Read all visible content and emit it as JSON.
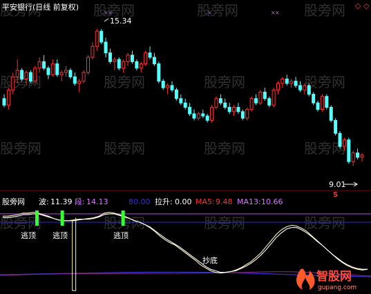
{
  "title": "平安银行(日线 前复权)",
  "price_labels": {
    "high": "15.34",
    "low": "9.01"
  },
  "watermark": "股旁网",
  "indicator_name": "股旁网",
  "indicator_values": [
    {
      "label": "波:",
      "value": "11.39",
      "color": "#ffffff"
    },
    {
      "label": "段:",
      "value": "14.13",
      "color": "#d878ff"
    },
    {
      "label": "",
      "value": "80.00",
      "color": "#3030d0"
    },
    {
      "label": "拉升:",
      "value": "0.00",
      "color": "#ffffff"
    },
    {
      "label": "MA5:",
      "value": "9.48",
      "color": "#ff3030"
    },
    {
      "label": "MA13:",
      "value": "10.66",
      "color": "#d878ff"
    }
  ],
  "annotations": {
    "escape_top": "逃顶",
    "bottom_fish": "抄底",
    "low_marker": "S"
  },
  "logo": {
    "text": "智股网",
    "sub": "gupang.com"
  },
  "colors": {
    "up": "#ff3333",
    "down": "#54ffff",
    "cross": "#d060ff",
    "purple_line": "#c040ff",
    "blue_line": "#3030d0",
    "signal": "#33ff33"
  },
  "chart_data": [
    {
      "type": "candlestick",
      "title": "平安银行(日线 前复权)",
      "y_range": [
        8.0,
        16.0
      ],
      "annotations": {
        "max": 15.34,
        "min": 9.01
      },
      "candles": [
        [
          12.1,
          12.3,
          11.7,
          11.8
        ],
        [
          11.8,
          12.6,
          11.6,
          12.5
        ],
        [
          12.5,
          13.3,
          12.3,
          13.1
        ],
        [
          13.1,
          13.9,
          12.8,
          13.4
        ],
        [
          13.4,
          13.5,
          12.9,
          13.0
        ],
        [
          13.0,
          13.4,
          12.7,
          13.3
        ],
        [
          13.3,
          13.4,
          12.8,
          12.9
        ],
        [
          12.9,
          13.6,
          12.8,
          13.5
        ],
        [
          13.5,
          14.0,
          13.3,
          13.8
        ],
        [
          13.8,
          14.1,
          13.4,
          13.5
        ],
        [
          13.5,
          13.6,
          13.0,
          13.2
        ],
        [
          13.2,
          13.9,
          13.1,
          13.7
        ],
        [
          13.7,
          13.9,
          13.1,
          13.2
        ],
        [
          13.2,
          13.4,
          12.9,
          13.3
        ],
        [
          13.3,
          13.6,
          13.1,
          13.4
        ],
        [
          13.4,
          13.5,
          13.0,
          13.1
        ],
        [
          13.1,
          13.3,
          12.7,
          12.8
        ],
        [
          12.8,
          13.0,
          12.4,
          12.9
        ],
        [
          12.9,
          13.4,
          12.8,
          13.3
        ],
        [
          13.3,
          14.1,
          13.2,
          14.0
        ],
        [
          14.0,
          14.7,
          13.9,
          14.5
        ],
        [
          14.5,
          15.3,
          14.3,
          15.2
        ],
        [
          15.2,
          15.3,
          14.6,
          14.7
        ],
        [
          14.7,
          14.9,
          14.0,
          14.2
        ],
        [
          14.2,
          14.4,
          13.7,
          13.8
        ],
        [
          13.8,
          14.0,
          13.4,
          13.9
        ],
        [
          13.9,
          14.0,
          13.4,
          13.5
        ],
        [
          13.5,
          13.9,
          13.3,
          13.8
        ],
        [
          13.8,
          14.2,
          13.6,
          14.1
        ],
        [
          14.1,
          14.3,
          13.7,
          13.8
        ],
        [
          13.8,
          13.9,
          13.4,
          13.5
        ],
        [
          13.5,
          13.8,
          13.3,
          13.7
        ],
        [
          13.7,
          14.3,
          13.6,
          14.2
        ],
        [
          14.2,
          14.5,
          13.9,
          14.0
        ],
        [
          14.0,
          14.2,
          13.6,
          13.7
        ],
        [
          13.7,
          13.8,
          12.8,
          12.9
        ],
        [
          12.9,
          13.0,
          12.5,
          12.6
        ],
        [
          12.6,
          12.8,
          12.3,
          12.7
        ],
        [
          12.7,
          12.9,
          12.4,
          12.5
        ],
        [
          12.5,
          12.6,
          12.0,
          12.1
        ],
        [
          12.1,
          12.3,
          11.8,
          11.9
        ],
        [
          11.9,
          12.1,
          11.6,
          11.7
        ],
        [
          11.7,
          11.9,
          11.3,
          11.4
        ],
        [
          11.4,
          11.6,
          11.1,
          11.2
        ],
        [
          11.2,
          11.5,
          11.1,
          11.4
        ],
        [
          11.4,
          11.6,
          11.2,
          11.3
        ],
        [
          11.3,
          11.4,
          11.0,
          11.1
        ],
        [
          11.1,
          11.8,
          11.0,
          11.7
        ],
        [
          11.7,
          12.2,
          11.6,
          12.1
        ],
        [
          12.1,
          12.3,
          11.8,
          11.9
        ],
        [
          11.9,
          12.1,
          11.6,
          11.7
        ],
        [
          11.7,
          11.9,
          11.4,
          11.5
        ],
        [
          11.5,
          11.8,
          11.3,
          11.7
        ],
        [
          11.7,
          11.9,
          11.4,
          11.5
        ],
        [
          11.5,
          11.6,
          11.1,
          11.2
        ],
        [
          11.2,
          11.7,
          11.1,
          11.6
        ],
        [
          11.6,
          12.2,
          11.5,
          12.1
        ],
        [
          12.1,
          12.3,
          11.8,
          11.9
        ],
        [
          11.9,
          12.5,
          11.8,
          12.4
        ],
        [
          12.4,
          12.6,
          12.0,
          12.1
        ],
        [
          12.1,
          12.2,
          11.7,
          11.8
        ],
        [
          11.8,
          12.6,
          11.7,
          12.5
        ],
        [
          12.5,
          12.9,
          12.3,
          12.8
        ],
        [
          12.8,
          13.1,
          12.6,
          13.0
        ],
        [
          13.0,
          13.2,
          12.7,
          12.8
        ],
        [
          12.8,
          13.0,
          12.6,
          12.9
        ],
        [
          12.9,
          13.1,
          12.6,
          12.7
        ],
        [
          12.7,
          12.9,
          12.4,
          12.5
        ],
        [
          12.5,
          12.8,
          12.3,
          12.7
        ],
        [
          12.7,
          12.8,
          12.2,
          12.3
        ],
        [
          12.3,
          12.4,
          11.8,
          11.9
        ],
        [
          11.9,
          12.0,
          11.5,
          11.6
        ],
        [
          11.6,
          12.3,
          11.5,
          12.2
        ],
        [
          12.2,
          12.3,
          11.6,
          11.7
        ],
        [
          11.7,
          11.8,
          11.0,
          11.1
        ],
        [
          11.1,
          11.2,
          10.4,
          10.5
        ],
        [
          10.5,
          10.6,
          9.8,
          9.9
        ],
        [
          9.9,
          10.3,
          9.7,
          10.2
        ],
        [
          10.2,
          10.3,
          9.1,
          9.2
        ],
        [
          9.2,
          9.7,
          9.0,
          9.6
        ],
        [
          9.6,
          9.8,
          9.3,
          9.4
        ],
        [
          9.4,
          9.6,
          9.2,
          9.5
        ]
      ]
    },
    {
      "type": "line",
      "name": "股旁网",
      "y_range": [
        0,
        100
      ],
      "series": [
        {
          "name": "波",
          "color": "#ffffff",
          "values": [
            88,
            88,
            89,
            90,
            92,
            92,
            93,
            92,
            90,
            88,
            85,
            83,
            82,
            82,
            83,
            84,
            84,
            85,
            86,
            88,
            92,
            93,
            92,
            90,
            88,
            85,
            82,
            80,
            77,
            73,
            68,
            62,
            57,
            53,
            50,
            45,
            40,
            35,
            30,
            24,
            20,
            16,
            14,
            13,
            14,
            15,
            17,
            20,
            24,
            28,
            34,
            40,
            48,
            56,
            64,
            70,
            74,
            76,
            75,
            72,
            68,
            62,
            56,
            50,
            44,
            38,
            32,
            27,
            23,
            20,
            18,
            17,
            18
          ]
        },
        {
          "name": "段",
          "color": "#d878ff",
          "values": [
            86,
            86,
            87,
            88,
            90,
            90,
            91,
            91,
            89,
            87,
            85,
            83,
            82,
            82,
            82,
            83,
            84,
            84,
            85,
            87,
            90,
            91,
            91,
            89,
            87,
            85,
            82,
            80,
            77,
            74,
            69,
            64,
            59,
            55,
            51,
            47,
            42,
            37,
            32,
            27,
            22,
            18,
            16,
            14,
            14,
            15,
            16,
            19,
            22,
            26,
            31,
            37,
            44,
            52,
            60,
            66,
            71,
            73,
            73,
            70,
            66,
            61,
            55,
            50,
            44,
            38,
            33,
            28,
            24,
            21,
            19,
            18,
            18
          ]
        }
      ],
      "reference_lines": [
        {
          "name": "80.00",
          "value": 80.0,
          "color": "#3030d0"
        },
        {
          "value": 91.0,
          "color": "#c040ff"
        }
      ],
      "signals": [
        {
          "type": "逃顶",
          "index": 3
        },
        {
          "type": "逃顶",
          "index": 8
        },
        {
          "type": "逃顶",
          "index": 20
        },
        {
          "type": "抄底",
          "index": 42
        }
      ],
      "values_shown": {
        "波": 11.39,
        "段": 14.13,
        "拉升": 0.0,
        "MA5": 9.48,
        "MA13": 10.66
      }
    }
  ]
}
